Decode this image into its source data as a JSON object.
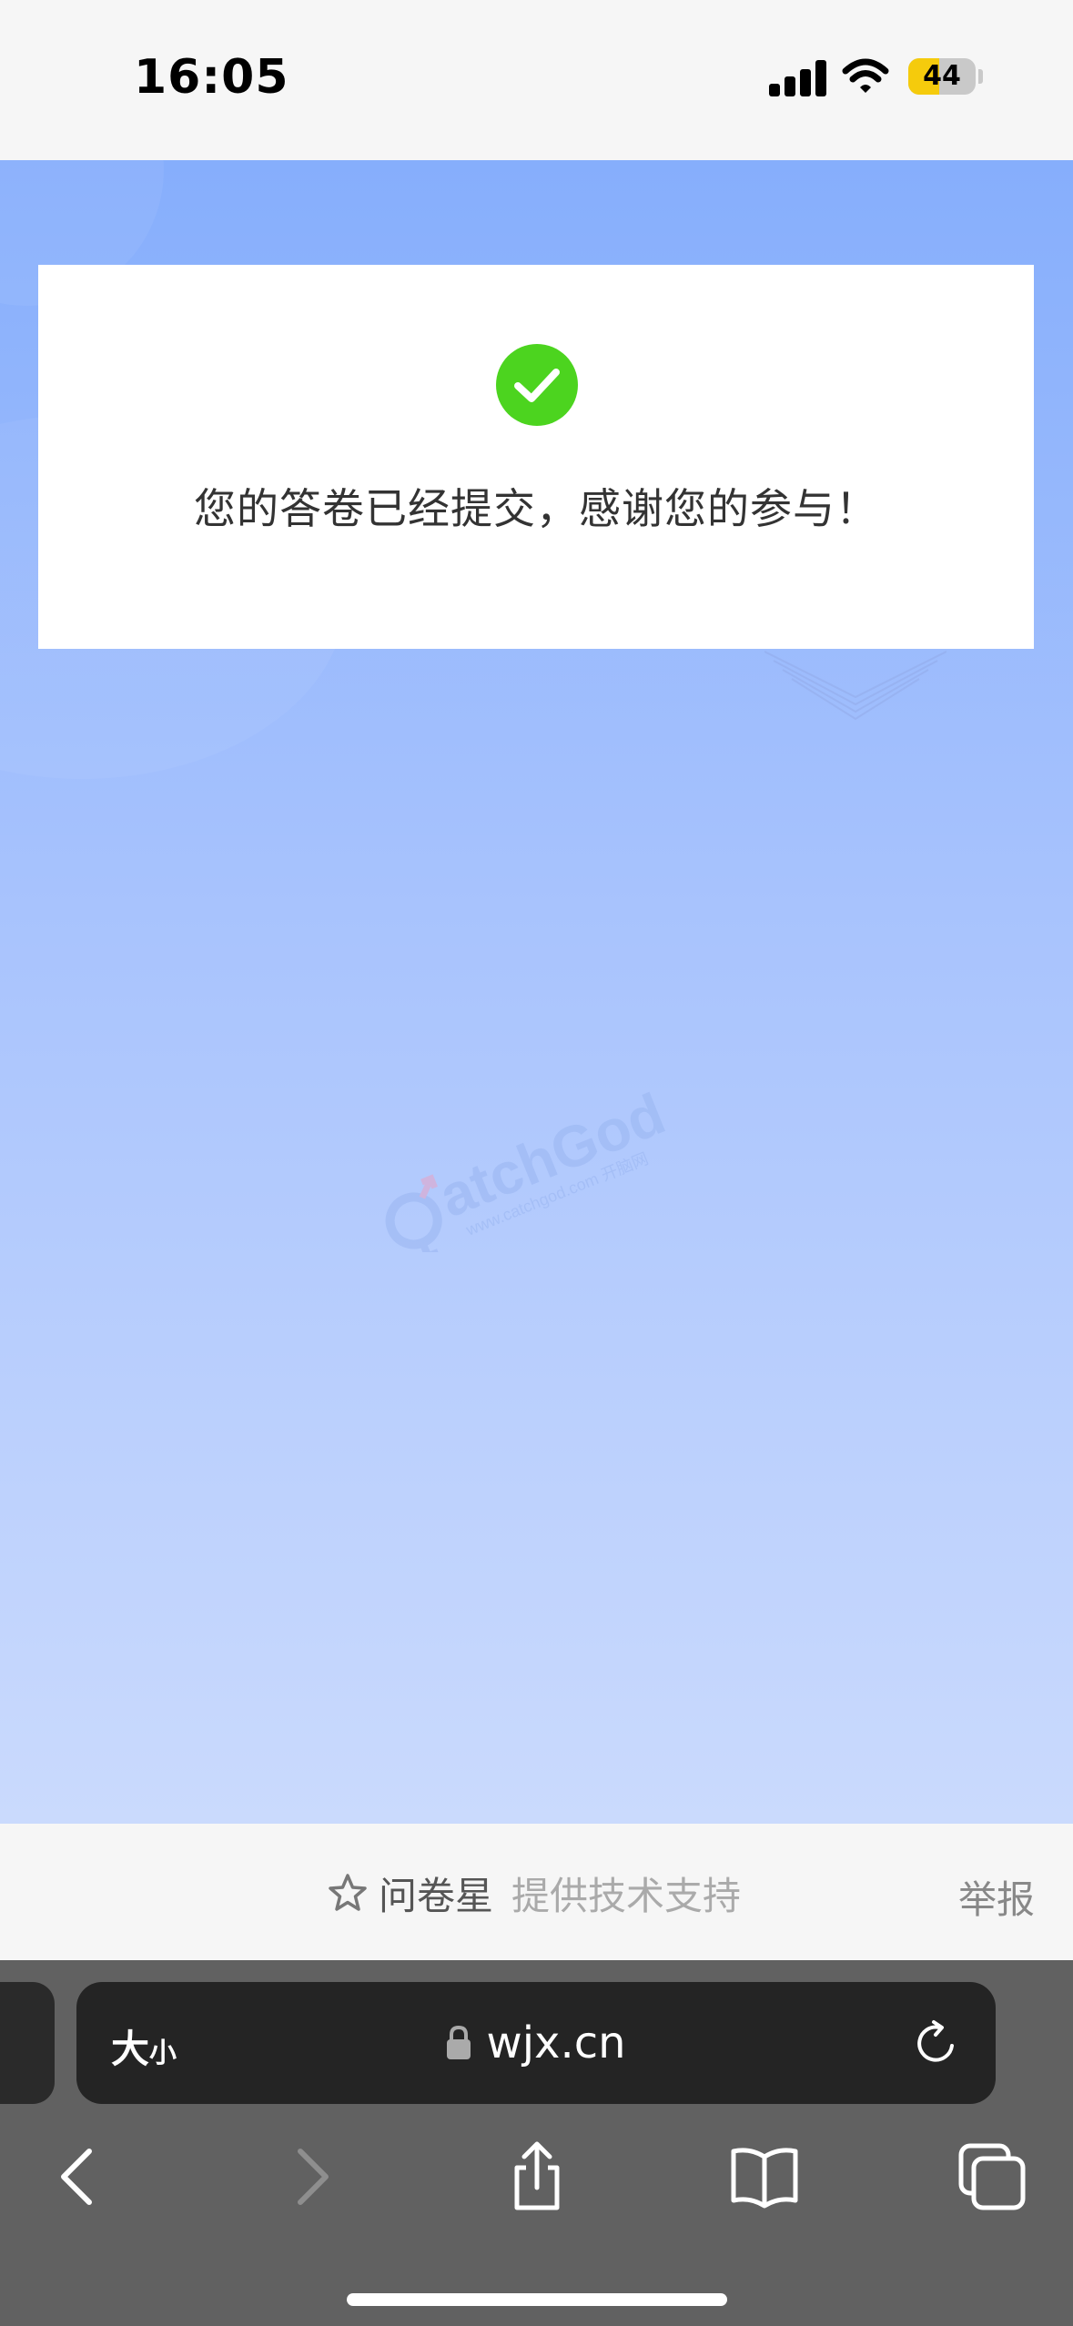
{
  "status_bar": {
    "time": "16:05",
    "battery_percent": "44",
    "battery_color": "#f5cb0c"
  },
  "result_card": {
    "icon": "check-circle-icon",
    "icon_color": "#4cd41f",
    "message": "您的答卷已经提交，感谢您的参与！"
  },
  "watermark": {
    "brand": "atchGod",
    "site": "www.catchgod.com 开脑网"
  },
  "footer": {
    "star_icon": "star-outline-icon",
    "brand_name": "问卷星",
    "brand_sub": "提供技术支持",
    "report_label": "举报"
  },
  "browser": {
    "text_size_big": "大",
    "text_size_small": "小",
    "url": "wjx.cn",
    "toolbar_icons": [
      "back-arrow-icon",
      "forward-arrow-icon",
      "share-icon",
      "bookmarks-icon",
      "tabs-icon"
    ]
  }
}
